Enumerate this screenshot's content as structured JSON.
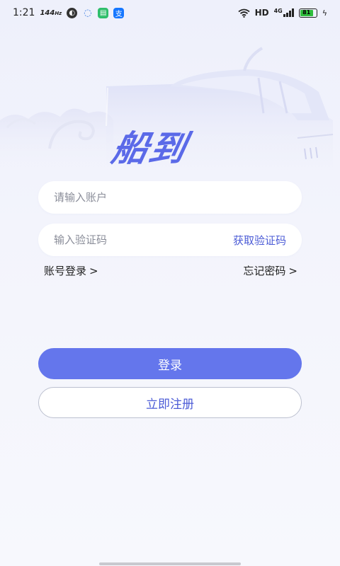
{
  "status_bar": {
    "time": "1:21",
    "refresh_rate": "144",
    "refresh_unit": "Hz",
    "hd": "HD",
    "network": "4G",
    "battery": "81"
  },
  "brand": {
    "title": "船到"
  },
  "form": {
    "account_placeholder": "请输入账户",
    "code_placeholder": "输入验证码",
    "get_code_label": "获取验证码",
    "account_login_label": "账号登录",
    "forgot_password_label": "忘记密码",
    "chevron": ">"
  },
  "actions": {
    "login_label": "登录",
    "register_label": "立即注册"
  },
  "colors": {
    "accent": "#6476ec",
    "link": "#4b5bd6"
  }
}
